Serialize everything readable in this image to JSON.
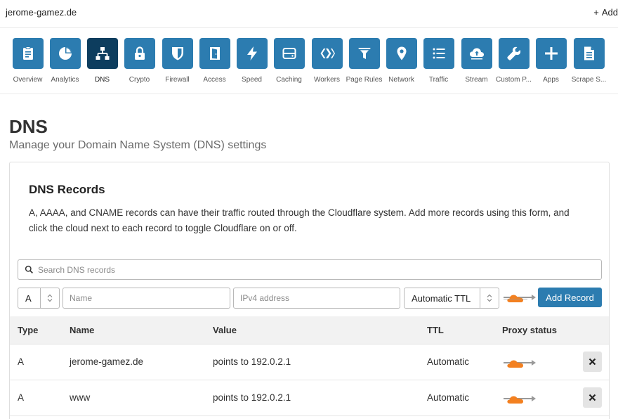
{
  "header": {
    "site_name": "jerome-gamez.de",
    "add_site_label": "Add"
  },
  "apps": [
    {
      "label": "Overview",
      "icon": "clipboard-icon"
    },
    {
      "label": "Analytics",
      "icon": "pie-chart-icon"
    },
    {
      "label": "DNS",
      "icon": "network-tree-icon",
      "active": true
    },
    {
      "label": "Crypto",
      "icon": "lock-icon"
    },
    {
      "label": "Firewall",
      "icon": "shield-icon"
    },
    {
      "label": "Access",
      "icon": "door-icon"
    },
    {
      "label": "Speed",
      "icon": "lightning-icon"
    },
    {
      "label": "Caching",
      "icon": "server-drive-icon"
    },
    {
      "label": "Workers",
      "icon": "workers-chevrons-icon"
    },
    {
      "label": "Page Rules",
      "icon": "filter-icon"
    },
    {
      "label": "Network",
      "icon": "location-pin-icon"
    },
    {
      "label": "Traffic",
      "icon": "list-icon"
    },
    {
      "label": "Stream",
      "icon": "cloud-upload-icon"
    },
    {
      "label": "Custom P...",
      "icon": "wrench-icon"
    },
    {
      "label": "Apps",
      "icon": "plus-icon"
    },
    {
      "label": "Scrape S...",
      "icon": "document-icon"
    }
  ],
  "page": {
    "title": "DNS",
    "subtitle": "Manage your Domain Name System (DNS) settings"
  },
  "records_card": {
    "title": "DNS Records",
    "description": "A, AAAA, and CNAME records can have their traffic routed through the Cloudflare system. Add more records using this form, and click the cloud next to each record to toggle Cloudflare on or off.",
    "search_placeholder": "Search DNS records",
    "form": {
      "type_value": "A",
      "name_placeholder": "Name",
      "value_placeholder": "IPv4 address",
      "ttl_value": "Automatic TTL",
      "add_button_label": "Add Record"
    },
    "columns": [
      "Type",
      "Name",
      "Value",
      "TTL",
      "Proxy status"
    ],
    "rows": [
      {
        "type": "A",
        "name": "jerome-gamez.de",
        "value": "points to 192.0.2.1",
        "ttl": "Automatic"
      },
      {
        "type": "A",
        "name": "www",
        "value": "points to 192.0.2.1",
        "ttl": "Automatic"
      }
    ]
  },
  "colors": {
    "accent": "#2c7cb0",
    "active_tile": "#0d3d5e",
    "proxy_orange": "#f38020"
  }
}
